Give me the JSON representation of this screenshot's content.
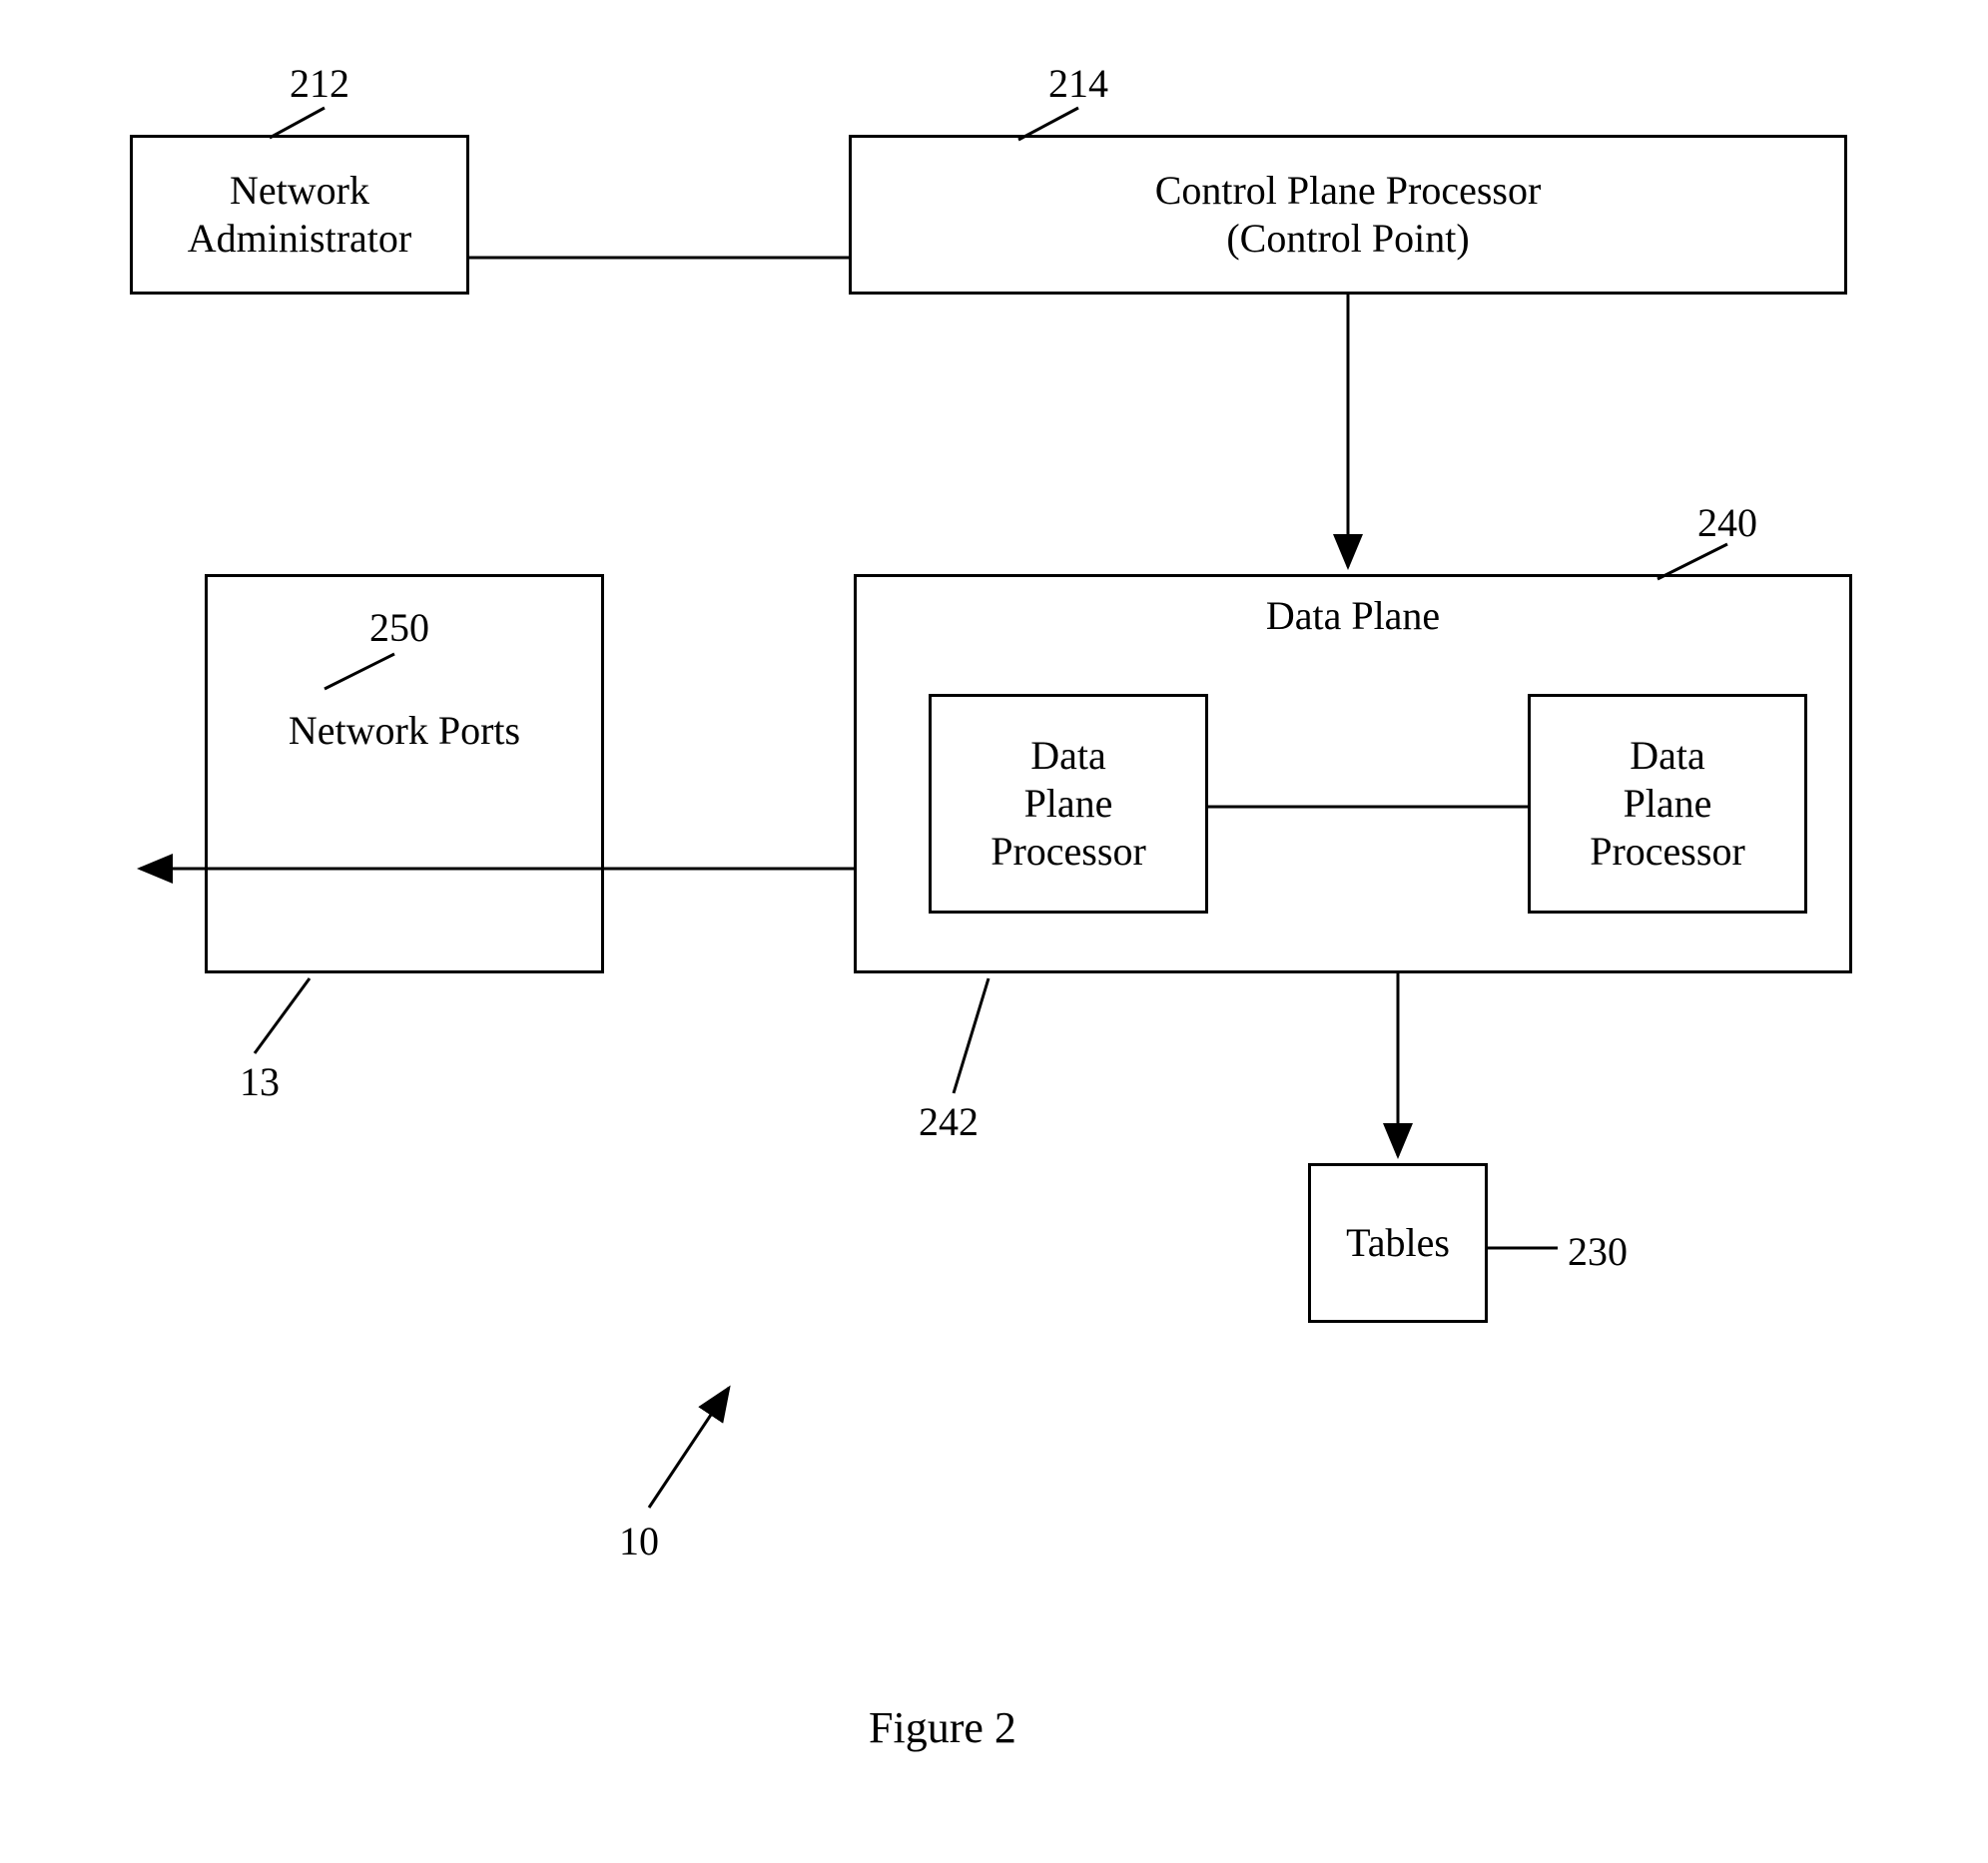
{
  "boxes": {
    "networkAdmin": "Network\nAdministrator",
    "controlPlane": "Control Plane Processor\n(Control Point)",
    "networkPorts": "Network Ports",
    "dataPlane": "Data Plane",
    "dpp1": "Data\nPlane\nProcessor",
    "dpp2": "Data\nPlane\nProcessor",
    "tables": "Tables"
  },
  "labels": {
    "l212": "212",
    "l214": "214",
    "l250": "250",
    "l240": "240",
    "l13": "13",
    "l242": "242",
    "l230": "230",
    "l10": "10"
  },
  "caption": "Figure 2"
}
